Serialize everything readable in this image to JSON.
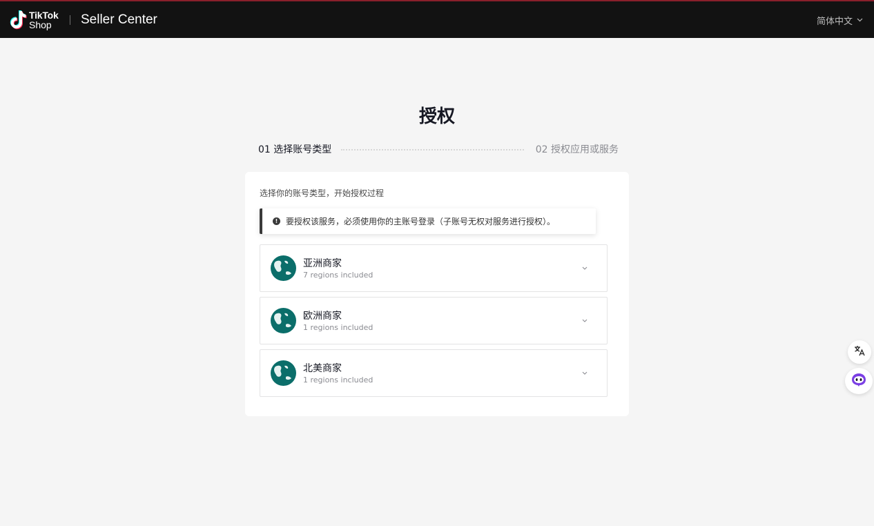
{
  "header": {
    "logo_line1": "TikTok",
    "logo_line2": "Shop",
    "brand": "Seller Center",
    "language": "简体中文"
  },
  "page": {
    "title": "授权"
  },
  "steps": [
    {
      "label": "01 选择账号类型",
      "state": "active"
    },
    {
      "label": "02 授权应用或服务",
      "state": "inactive"
    }
  ],
  "card": {
    "description": "选择你的账号类型，开始授权过程",
    "notice": "要授权该服务，必须使用你的主账号登录（子账号无权对服务进行授权）。",
    "regions": [
      {
        "name": "亚洲商家",
        "subtitle": "7 regions included"
      },
      {
        "name": "欧洲商家",
        "subtitle": "1 regions included"
      },
      {
        "name": "北美商家",
        "subtitle": "1 regions included"
      }
    ]
  },
  "colors": {
    "header_bg": "#121212",
    "globe": "#0b6e6a",
    "page_bg": "#f5f5f5",
    "assistant_accent": "#7b3fe4"
  },
  "icons": {
    "globe": "globe-icon",
    "chevron": "chevron-down-icon",
    "info": "info-icon",
    "translate": "translate-icon",
    "assistant": "assistant-bot-icon"
  }
}
